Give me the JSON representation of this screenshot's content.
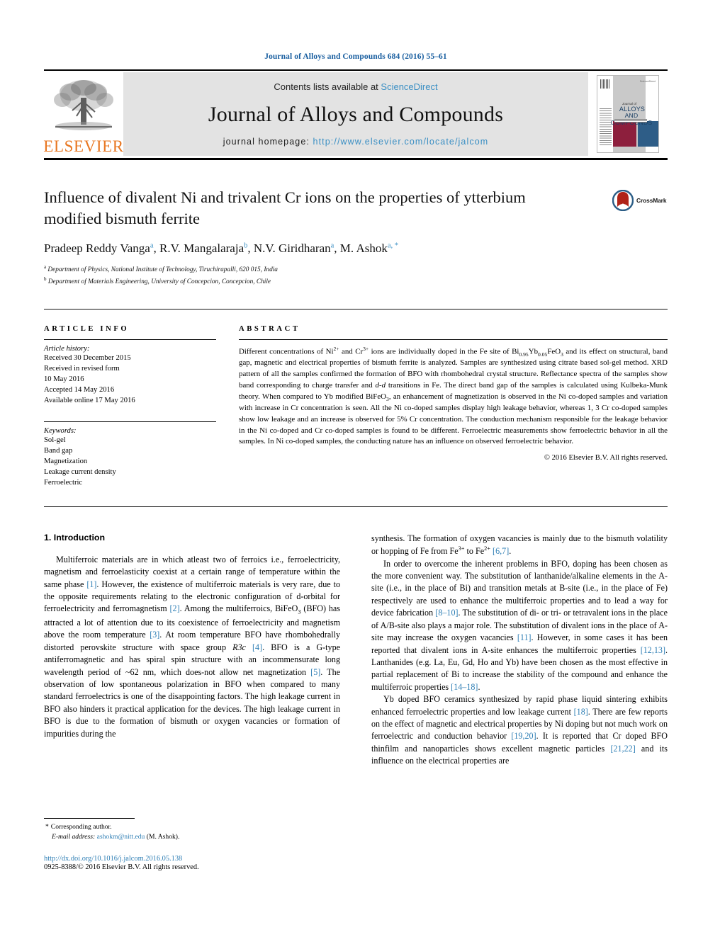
{
  "running_head": "Journal of Alloys and Compounds 684 (2016) 55–61",
  "banner": {
    "contents_prefix": "Contents lists available at ",
    "sciencedirect": "ScienceDirect",
    "journal_name": "Journal of Alloys and Compounds",
    "homepage_prefix": "journal homepage: ",
    "homepage_url": "http://www.elsevier.com/locate/jalcom",
    "publisher": "ELSEVIER",
    "cover": {
      "line1": "Journal of",
      "line2": "ALLOYS",
      "line3": "AND COMPOUNDS",
      "corner_note": "ScienceDirect"
    },
    "link_color": "#3a8fc4"
  },
  "crossmark": {
    "label": "CrossMark"
  },
  "title": "Influence of divalent Ni and trivalent Cr ions on the properties of ytterbium modified bismuth ferrite",
  "authors": [
    {
      "name": "Pradeep Reddy Vanga",
      "sup": "a"
    },
    {
      "name": "R.V. Mangalaraja",
      "sup": "b"
    },
    {
      "name": "N.V. Giridharan",
      "sup": "a"
    },
    {
      "name": "M. Ashok",
      "sup": "a, *"
    }
  ],
  "affiliations": [
    {
      "mark": "a",
      "text": "Department of Physics, National Institute of Technology, Tiruchirapalli, 620 015, India"
    },
    {
      "mark": "b",
      "text": "Department of Materials Engineering, University of Concepcion, Concepcion, Chile"
    }
  ],
  "article_info": {
    "heading": "ARTICLE INFO",
    "history_label": "Article history:",
    "history": [
      "Received 30 December 2015",
      "Received in revised form",
      "10 May 2016",
      "Accepted 14 May 2016",
      "Available online 17 May 2016"
    ],
    "keywords_label": "Keywords:",
    "keywords": [
      "Sol-gel",
      "Band gap",
      "Magnetization",
      "Leakage current density",
      "Ferroelectric"
    ]
  },
  "abstract": {
    "heading": "ABSTRACT",
    "copyright": "© 2016 Elsevier B.V. All rights reserved.",
    "paragraph_parts": [
      {
        "t": "Different concentrations of Ni"
      },
      {
        "t": "2+",
        "s": "sup"
      },
      {
        "t": " and Cr"
      },
      {
        "t": "3+",
        "s": "sup"
      },
      {
        "t": " ions are individually doped in the Fe site of Bi"
      },
      {
        "t": "0.95",
        "s": "sub"
      },
      {
        "t": "Yb"
      },
      {
        "t": "0.05",
        "s": "sub"
      },
      {
        "t": "FeO"
      },
      {
        "t": "3",
        "s": "sub"
      },
      {
        "t": " and its effect on structural, band gap, magnetic and electrical properties of bismuth ferrite is analyzed. Samples are synthesized using citrate based sol-gel method. XRD pattern of all the samples confirmed the formation of BFO with rhombohedral crystal structure. Reflectance spectra of the samples show band corresponding to charge transfer and "
      },
      {
        "t": "d-d",
        "s": "em"
      },
      {
        "t": " transitions in Fe. The direct band gap of the samples is calculated using Kulbeka-Munk theory. When compared to Yb modified BiFeO"
      },
      {
        "t": "3",
        "s": "sub"
      },
      {
        "t": ", an enhancement of magnetization is observed in the Ni co-doped samples and variation with increase in Cr concentration is seen. All the Ni co-doped samples display high leakage behavior, whereas 1, 3 Cr co-doped samples show low leakage and an increase is observed for 5% Cr concentration. The conduction mechanism responsible for the leakage behavior in the Ni co-doped and Cr co-doped samples is found to be different. Ferroelectric measurements show ferroelectric behavior in all the samples. In Ni co-doped samples, the conducting nature has an influence on observed ferroelectric behavior."
      }
    ]
  },
  "intro": {
    "heading": "1. Introduction",
    "left_parts": [
      {
        "t": "Multiferroic materials are in which atleast two of ferroics i.e., ferroelectricity, magnetism and ferroelasticity coexist at a certain range of temperature within the same phase "
      },
      {
        "t": "[1]",
        "s": "ref"
      },
      {
        "t": ". However, the existence of multiferroic materials is very rare, due to the opposite requirements relating to the electronic configuration of d-orbital for ferroelectricity and ferromagnetism "
      },
      {
        "t": "[2]",
        "s": "ref"
      },
      {
        "t": ". Among the multiferroics, BiFeO"
      },
      {
        "t": "3",
        "s": "sub"
      },
      {
        "t": " (BFO) has attracted a lot of attention due to its coexistence of ferroelectricity and magnetism above the room temperature "
      },
      {
        "t": "[3]",
        "s": "ref"
      },
      {
        "t": ". At room temperature BFO have rhombohedrally distorted perovskite structure with space group "
      },
      {
        "t": "R3c",
        "s": "em"
      },
      {
        "t": " "
      },
      {
        "t": "[4]",
        "s": "ref"
      },
      {
        "t": ". BFO is a G-type antiferromagnetic and has spiral spin structure with an incommensurate long wavelength period of ~62 nm, which does-not allow net magnetization "
      },
      {
        "t": "[5]",
        "s": "ref"
      },
      {
        "t": ". The observation of low spontaneous polarization in BFO when compared to many standard ferroelectrics is one of the disappointing factors. The high leakage current in BFO also hinders it practical application for the devices. The high leakage current in BFO is due to the formation of bismuth or oxygen vacancies or formation of impurities during the"
      }
    ],
    "right_p1_parts": [
      {
        "t": "synthesis. The formation of oxygen vacancies is mainly due to the bismuth volatility or hopping of Fe from Fe"
      },
      {
        "t": "3+",
        "s": "sup"
      },
      {
        "t": " to Fe"
      },
      {
        "t": "2+",
        "s": "sup"
      },
      {
        "t": " "
      },
      {
        "t": "[6,7]",
        "s": "ref"
      },
      {
        "t": "."
      }
    ],
    "right_p2_parts": [
      {
        "t": "In order to overcome the inherent problems in BFO, doping has been chosen as the more convenient way. The substitution of lanthanide/alkaline elements in the A-site (i.e., in the place of Bi) and transition metals at B-site (i.e., in the place of Fe) respectively are used to enhance the multiferroic properties and to lead a way for device fabrication "
      },
      {
        "t": "[8–10]",
        "s": "ref"
      },
      {
        "t": ". The substitution of di- or tri- or tetravalent ions in the place of A/B-site also plays a major role. The substitution of divalent ions in the place of A-site may increase the oxygen vacancies "
      },
      {
        "t": "[11]",
        "s": "ref"
      },
      {
        "t": ". However, in some cases it has been reported that divalent ions in A-site enhances the multiferroic properties "
      },
      {
        "t": "[12,13]",
        "s": "ref"
      },
      {
        "t": ". Lanthanides (e.g. La, Eu, Gd, Ho and Yb) have been chosen as the most effective in partial replacement of Bi to increase the stability of the compound and enhance the multiferroic properties "
      },
      {
        "t": "[14–18]",
        "s": "ref"
      },
      {
        "t": "."
      }
    ],
    "right_p3_parts": [
      {
        "t": "Yb doped BFO ceramics synthesized by rapid phase liquid sintering exhibits enhanced ferroelectric properties and low leakage current "
      },
      {
        "t": "[18]",
        "s": "ref"
      },
      {
        "t": ". There are few reports on the effect of magnetic and electrical properties by Ni doping but not much work on ferroelectric and conduction behavior "
      },
      {
        "t": "[19,20]",
        "s": "ref"
      },
      {
        "t": ". It is reported that Cr doped BFO thinfilm and nanoparticles shows excellent magnetic particles "
      },
      {
        "t": "[21,22]",
        "s": "ref"
      },
      {
        "t": " and its influence on the electrical properties are"
      }
    ]
  },
  "footnote": {
    "corresponding": "Corresponding author.",
    "email_label": "E-mail address:",
    "email": "ashokm@nitt.edu",
    "email_owner": "(M. Ashok).",
    "doi": "http://dx.doi.org/10.1016/j.jalcom.2016.05.138",
    "issn_line": "0925-8388/© 2016 Elsevier B.V. All rights reserved."
  }
}
